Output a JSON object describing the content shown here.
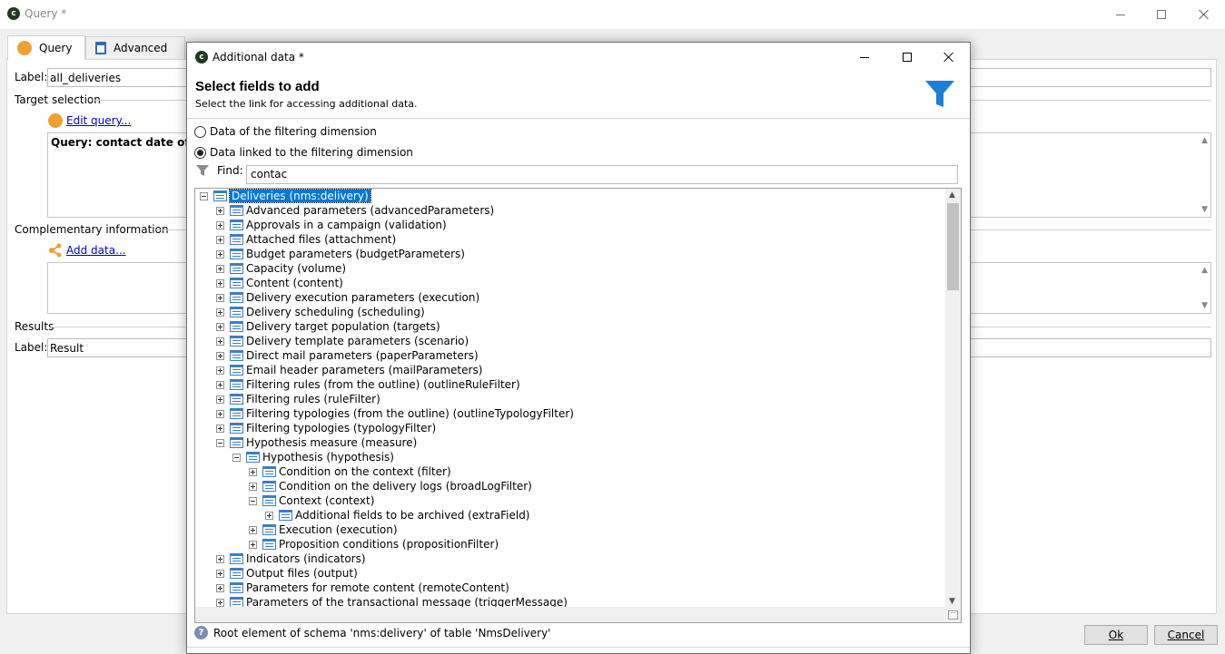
{
  "window": {
    "title": "Query *"
  },
  "tabs": [
    {
      "label": "Query",
      "icon": "query-icon"
    },
    {
      "label": "Advanced",
      "icon": "clipboard-icon"
    }
  ],
  "form": {
    "label_caption": "Label:",
    "label_value": "all_deliveries",
    "target_selection_title": "Target selection",
    "edit_query_link": "Edit query...",
    "query_text": "Query: contact date of deli",
    "complementary_title": "Complementary information",
    "add_data_link": "Add data...",
    "results_title": "Results",
    "results_label_caption": "Label:",
    "results_label_value": "Result"
  },
  "buttons": {
    "ok": "Ok",
    "cancel": "Cancel"
  },
  "dialog": {
    "title": "Additional data *",
    "heading": "Select fields to add",
    "subheading": "Select the link for accessing additional data.",
    "radio_filtering": "Data of the filtering dimension",
    "radio_linked": "Data linked to the filtering dimension",
    "find_label": "Find:",
    "find_value": "contac",
    "status_text": "Root element of schema 'nms:delivery' of table 'NmsDelivery'"
  },
  "tree": [
    {
      "label": "Deliveries (nms:delivery)",
      "level": 0,
      "state": "minus",
      "selected": true
    },
    {
      "label": "Advanced parameters (advancedParameters)",
      "level": 1,
      "state": "plus"
    },
    {
      "label": "Approvals in a campaign (validation)",
      "level": 1,
      "state": "plus"
    },
    {
      "label": "Attached files (attachment)",
      "level": 1,
      "state": "plus"
    },
    {
      "label": "Budget parameters (budgetParameters)",
      "level": 1,
      "state": "plus"
    },
    {
      "label": "Capacity (volume)",
      "level": 1,
      "state": "plus"
    },
    {
      "label": "Content (content)",
      "level": 1,
      "state": "plus"
    },
    {
      "label": "Delivery execution parameters (execution)",
      "level": 1,
      "state": "plus"
    },
    {
      "label": "Delivery scheduling (scheduling)",
      "level": 1,
      "state": "plus"
    },
    {
      "label": "Delivery target population (targets)",
      "level": 1,
      "state": "plus"
    },
    {
      "label": "Delivery template parameters (scenario)",
      "level": 1,
      "state": "plus"
    },
    {
      "label": "Direct mail parameters (paperParameters)",
      "level": 1,
      "state": "plus"
    },
    {
      "label": "Email header parameters (mailParameters)",
      "level": 1,
      "state": "plus"
    },
    {
      "label": "Filtering rules (from the outline) (outlineRuleFilter)",
      "level": 1,
      "state": "plus"
    },
    {
      "label": "Filtering rules (ruleFilter)",
      "level": 1,
      "state": "plus"
    },
    {
      "label": "Filtering typologies (from the outline) (outlineTypologyFilter)",
      "level": 1,
      "state": "plus"
    },
    {
      "label": "Filtering typologies (typologyFilter)",
      "level": 1,
      "state": "plus"
    },
    {
      "label": "Hypothesis measure (measure)",
      "level": 1,
      "state": "minus"
    },
    {
      "label": "Hypothesis (hypothesis)",
      "level": 2,
      "state": "minus"
    },
    {
      "label": "Condition on the context (filter)",
      "level": 3,
      "state": "plus"
    },
    {
      "label": "Condition on the delivery logs (broadLogFilter)",
      "level": 3,
      "state": "plus"
    },
    {
      "label": "Context (context)",
      "level": 3,
      "state": "minus"
    },
    {
      "label": "Additional fields to be archived (extraField)",
      "level": 4,
      "state": "plus"
    },
    {
      "label": "Execution (execution)",
      "level": 3,
      "state": "plus"
    },
    {
      "label": "Proposition conditions (propositionFilter)",
      "level": 3,
      "state": "plus"
    },
    {
      "label": "Indicators (indicators)",
      "level": 1,
      "state": "plus"
    },
    {
      "label": "Output files (output)",
      "level": 1,
      "state": "plus"
    },
    {
      "label": "Parameters for remote content (remoteContent)",
      "level": 1,
      "state": "plus"
    },
    {
      "label": "Parameters of the transactional message (triggerMessage)",
      "level": 1,
      "state": "plus"
    }
  ],
  "colors": {
    "accent": "#0078d7",
    "orange": "#f0a030",
    "funnel": "#1e7fd6"
  }
}
